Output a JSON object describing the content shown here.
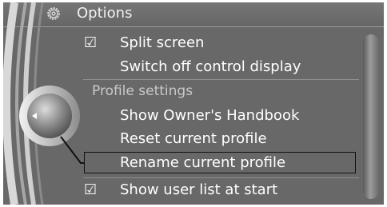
{
  "header": {
    "title": "Options",
    "icon": "gear-icon"
  },
  "menu": {
    "split_screen": {
      "label": "Split screen",
      "checked": true
    },
    "switch_off_display": {
      "label": "Switch off control display"
    },
    "section_profile": "Profile settings",
    "show_handbook": {
      "label": "Show Owner's Handbook"
    },
    "reset_profile": {
      "label": "Reset current profile"
    },
    "rename_profile": {
      "label": "Rename current profile",
      "selected": true
    },
    "show_user_list": {
      "label": "Show user list at start",
      "checked": true
    }
  },
  "controller": {
    "icon": "controller-knob-icon",
    "arrow_icon": "left-arrow-icon"
  },
  "colors": {
    "background": "#686868",
    "text": "#ffffff",
    "section_text": "#c9c9c9",
    "selection_border": "#111111"
  }
}
